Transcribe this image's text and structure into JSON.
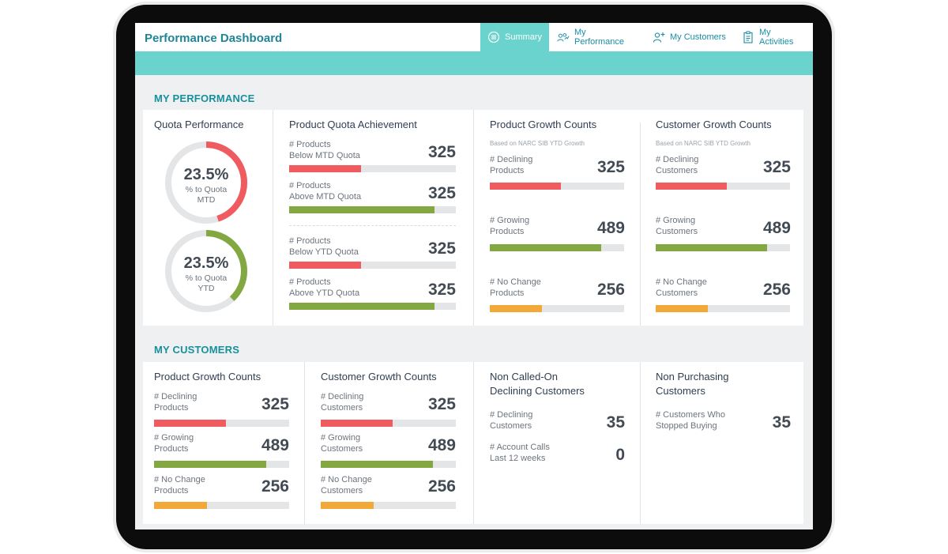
{
  "header": {
    "title": "Performance Dashboard",
    "nav": [
      {
        "label": "Summary",
        "icon": "list-circle-icon",
        "active": true
      },
      {
        "label": "My Performance",
        "icon": "people-chart-icon",
        "active": false
      },
      {
        "label": "My Customers",
        "icon": "person-add-icon",
        "active": false
      },
      {
        "label": "My Activities",
        "icon": "clipboard-icon",
        "active": false
      }
    ]
  },
  "colors": {
    "accent": "#6ad3cd",
    "title": "#1f8597",
    "negative": "#ef5b5e",
    "positive": "#83a842",
    "neutral": "#f3a93a"
  },
  "my_performance": {
    "section_title": "MY PERFORMANCE",
    "quota": {
      "title": "Quota Performance",
      "mtd": {
        "value": "23.5%",
        "label_line1": "% to Quota",
        "label_line2": "MTD",
        "fraction": 0.45
      },
      "ytd": {
        "value": "23.5%",
        "label_line1": "% to Quota",
        "label_line2": "YTD",
        "fraction": 0.38
      }
    },
    "product_quota": {
      "title": "Product Quota Achievement",
      "items": [
        {
          "line1": "# Products",
          "line2": "Below MTD Quota",
          "value": "325",
          "fraction": 0.43,
          "color": "red"
        },
        {
          "line1": "# Products",
          "line2": "Above MTD Quota",
          "value": "325",
          "fraction": 0.87,
          "color": "green"
        },
        {
          "line1": "# Products",
          "line2": "Below YTD Quota",
          "value": "325",
          "fraction": 0.43,
          "color": "red"
        },
        {
          "line1": "# Products",
          "line2": "Above YTD Quota",
          "value": "325",
          "fraction": 0.87,
          "color": "green"
        }
      ]
    },
    "product_growth": {
      "title": "Product Growth Counts",
      "note": "Based on NARC SIB YTD Growth",
      "items": [
        {
          "line1": "# Declining",
          "line2": "Products",
          "value": "325",
          "fraction": 0.53,
          "color": "red"
        },
        {
          "line1": "# Growing",
          "line2": "Products",
          "value": "489",
          "fraction": 0.83,
          "color": "green"
        },
        {
          "line1": "# No Change",
          "line2": "Products",
          "value": "256",
          "fraction": 0.39,
          "color": "orange"
        }
      ]
    },
    "customer_growth": {
      "title": "Customer Growth Counts",
      "note": "Based on NARC SIB YTD Growth",
      "items": [
        {
          "line1": "# Declining",
          "line2": "Customers",
          "value": "325",
          "fraction": 0.53,
          "color": "red"
        },
        {
          "line1": "# Growing",
          "line2": "Customers",
          "value": "489",
          "fraction": 0.83,
          "color": "green"
        },
        {
          "line1": "# No Change",
          "line2": "Customers",
          "value": "256",
          "fraction": 0.39,
          "color": "orange"
        }
      ]
    }
  },
  "my_customers": {
    "section_title": "MY CUSTOMERS",
    "product_growth": {
      "title": "Product Growth Counts",
      "items": [
        {
          "line1": "# Declining",
          "line2": "Products",
          "value": "325",
          "fraction": 0.53,
          "color": "red"
        },
        {
          "line1": "# Growing",
          "line2": "Products",
          "value": "489",
          "fraction": 0.83,
          "color": "green"
        },
        {
          "line1": "# No Change",
          "line2": "Products",
          "value": "256",
          "fraction": 0.39,
          "color": "orange"
        }
      ]
    },
    "customer_growth": {
      "title": "Customer Growth Counts",
      "items": [
        {
          "line1": "# Declining",
          "line2": "Customers",
          "value": "325",
          "fraction": 0.53,
          "color": "red"
        },
        {
          "line1": "# Growing",
          "line2": "Customers",
          "value": "489",
          "fraction": 0.83,
          "color": "green"
        },
        {
          "line1": "# No Change",
          "line2": "Customers",
          "value": "256",
          "fraction": 0.39,
          "color": "orange"
        }
      ]
    },
    "non_called_on": {
      "title_line1": "Non Called-On",
      "title_line2": "Declining Customers",
      "items": [
        {
          "line1": "# Declining",
          "line2": "Customers",
          "value": "35"
        },
        {
          "line1": "# Account Calls",
          "line2": "Last 12 weeks",
          "value": "0"
        }
      ]
    },
    "non_purchasing": {
      "title_line1": "Non Purchasing",
      "title_line2": "Customers",
      "items": [
        {
          "line1": "# Customers Who",
          "line2": "Stopped Buying",
          "value": "35"
        }
      ]
    }
  }
}
